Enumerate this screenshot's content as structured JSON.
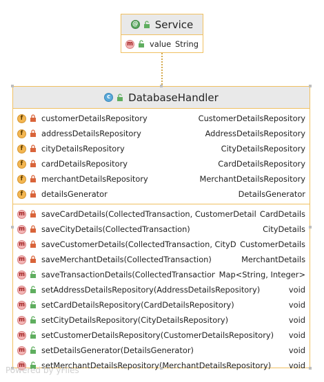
{
  "service": {
    "badge": "@",
    "title": "Service",
    "methods": [
      {
        "badge": "m",
        "name": "value()",
        "type": "String"
      }
    ]
  },
  "handler": {
    "badge": "c",
    "title": "DatabaseHandler",
    "fields": [
      {
        "badge": "f",
        "name": "customerDetailsRepository",
        "type": "CustomerDetailsRepository"
      },
      {
        "badge": "f",
        "name": "addressDetailsRepository",
        "type": "AddressDetailsRepository"
      },
      {
        "badge": "f",
        "name": "cityDetailsRepository",
        "type": "CityDetailsRepository"
      },
      {
        "badge": "f",
        "name": "cardDetailsRepository",
        "type": "CardDetailsRepository"
      },
      {
        "badge": "f",
        "name": "merchantDetailsRepository",
        "type": "MerchantDetailsRepository"
      },
      {
        "badge": "f",
        "name": "detailsGenerator",
        "type": "DetailsGenerator"
      }
    ],
    "methods": [
      {
        "badge": "m",
        "name": "saveCardDetails(CollectedTransaction, CustomerDetails)",
        "type": "CardDetails"
      },
      {
        "badge": "m",
        "name": "saveCityDetails(CollectedTransaction)",
        "type": "CityDetails"
      },
      {
        "badge": "m",
        "name": "saveCustomerDetails(CollectedTransaction, CityDetails)",
        "type": "CustomerDetails"
      },
      {
        "badge": "m",
        "name": "saveMerchantDetails(CollectedTransaction)",
        "type": "MerchantDetails"
      },
      {
        "badge": "m",
        "name": "saveTransactionDetails(CollectedTransaction)",
        "type": "Map<String, Integer>"
      },
      {
        "badge": "m",
        "name": "setAddressDetailsRepository(AddressDetailsRepository)",
        "type": "void"
      },
      {
        "badge": "m",
        "name": "setCardDetailsRepository(CardDetailsRepository)",
        "type": "void"
      },
      {
        "badge": "m",
        "name": "setCityDetailsRepository(CityDetailsRepository)",
        "type": "void"
      },
      {
        "badge": "m",
        "name": "setCustomerDetailsRepository(CustomerDetailsRepository)",
        "type": "void"
      },
      {
        "badge": "m",
        "name": "setDetailsGenerator(DetailsGenerator)",
        "type": "void"
      },
      {
        "badge": "m",
        "name": "setMerchantDetailsRepository(MerchantDetailsRepository)",
        "type": "void"
      }
    ]
  },
  "watermark": "Powered by yFiles"
}
